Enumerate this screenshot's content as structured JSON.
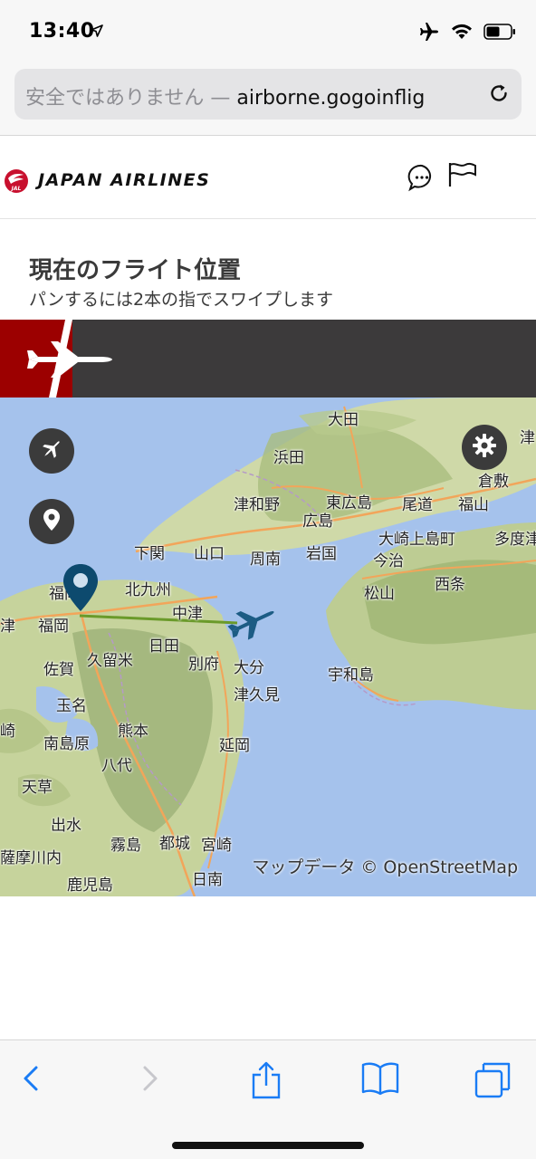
{
  "status": {
    "time": "13:40",
    "icons": [
      "location-arrow-icon",
      "airplane-mode-icon",
      "wifi-icon",
      "battery-icon"
    ]
  },
  "browser": {
    "url_insecure_label": "安全ではありません —",
    "url_host": "airborne.gogoinflig"
  },
  "header": {
    "brand": "JAPAN AIRLINES",
    "logo_text": "JAL",
    "brand_color": "#c8102e"
  },
  "section": {
    "title": "現在のフライト位置",
    "subtitle": "パンするには2本の指でスワイプします"
  },
  "map": {
    "places": [
      {
        "name": "大田"
      },
      {
        "name": "浜田"
      },
      {
        "name": "津"
      },
      {
        "name": "倉敷"
      },
      {
        "name": "津和野"
      },
      {
        "name": "東広島"
      },
      {
        "name": "尾道"
      },
      {
        "name": "福山"
      },
      {
        "name": "広島"
      },
      {
        "name": "大崎上島町"
      },
      {
        "name": "多度津"
      },
      {
        "name": "下関"
      },
      {
        "name": "山口"
      },
      {
        "name": "周南"
      },
      {
        "name": "岩国"
      },
      {
        "name": "今治"
      },
      {
        "name": "福岡"
      },
      {
        "name": "北九州"
      },
      {
        "name": "松山"
      },
      {
        "name": "西条"
      },
      {
        "name": "中津"
      },
      {
        "name": "津"
      },
      {
        "name": "福岡"
      },
      {
        "name": "日田"
      },
      {
        "name": "佐賀"
      },
      {
        "name": "久留米"
      },
      {
        "name": "別府"
      },
      {
        "name": "大分"
      },
      {
        "name": "宇和島"
      },
      {
        "name": "津久見"
      },
      {
        "name": "玉名"
      },
      {
        "name": "崎"
      },
      {
        "name": "熊本"
      },
      {
        "name": "南島原"
      },
      {
        "name": "延岡"
      },
      {
        "name": "八代"
      },
      {
        "name": "天草"
      },
      {
        "name": "出水"
      },
      {
        "name": "霧島"
      },
      {
        "name": "都城"
      },
      {
        "name": "宮崎"
      },
      {
        "name": "薩摩川内"
      },
      {
        "name": "日南"
      },
      {
        "name": "鹿児島"
      }
    ],
    "attribution": "マップデータ © OpenStreetMap",
    "route_color": "#6a9a2a",
    "marker_color": "#0d4a6e"
  },
  "toolbar": {
    "buttons": [
      "back",
      "forward",
      "share",
      "bookmarks",
      "tabs"
    ],
    "accent": "#1a7cf5"
  }
}
